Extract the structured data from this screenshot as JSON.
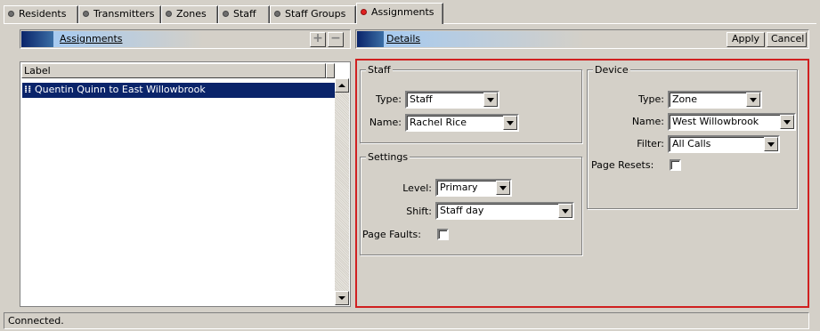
{
  "tabs": [
    {
      "label": "Residents"
    },
    {
      "label": "Transmitters"
    },
    {
      "label": "Zones"
    },
    {
      "label": "Staff"
    },
    {
      "label": "Staff Groups"
    },
    {
      "label": "Assignments",
      "active": true
    }
  ],
  "left_panel": {
    "title": "Assignments",
    "add_label": "+",
    "remove_label": "−",
    "column_header": "Label",
    "rows": [
      {
        "label": "Quentin Quinn to East Willowbrook",
        "selected": true
      }
    ]
  },
  "details": {
    "title": "Details",
    "apply_label": "Apply",
    "cancel_label": "Cancel",
    "staff": {
      "title": "Staff",
      "type_label": "Type:",
      "type_value": "Staff",
      "name_label": "Name:",
      "name_value": "Rachel Rice"
    },
    "settings": {
      "title": "Settings",
      "level_label": "Level:",
      "level_value": "Primary",
      "shift_label": "Shift:",
      "shift_value": "Staff day",
      "page_faults_label": "Page Faults:",
      "page_faults_checked": false
    },
    "device": {
      "title": "Device",
      "type_label": "Type:",
      "type_value": "Zone",
      "name_label": "Name:",
      "name_value": "West Willowbrook",
      "filter_label": "Filter:",
      "filter_value": "All Calls",
      "page_resets_label": "Page Resets:",
      "page_resets_checked": false
    }
  },
  "status": {
    "text": "Connected."
  },
  "colors": {
    "selection": "#0a246a",
    "highlight_border": "#d02020",
    "active_tab_dot": "#e02020"
  }
}
